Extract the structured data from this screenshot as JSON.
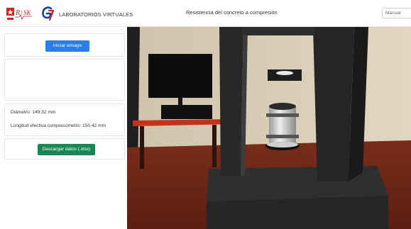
{
  "header": {
    "logo_text": "RISK",
    "brand_title": "LABORATORIOS VIRTUALES",
    "page_title": "Resistencia del concreto a compresión",
    "mode_select": {
      "selected": "Manual"
    }
  },
  "sidebar": {
    "start_button_label": "Iniciar ensayo",
    "diameter_text": "Diámetro: 149.32 mm",
    "length_text": "Longitud efectiva compresómetro: 150.42 mm",
    "download_button_label": "Descargar datos (.xlsx)"
  },
  "scene": {
    "wall_color": "#d8cdb6",
    "floor_color": "#6e2a1a",
    "frame_color": "#2a2a2a",
    "bench_color": "#c2321c",
    "accent_primary": "#2b7de9",
    "accent_success": "#198754"
  }
}
